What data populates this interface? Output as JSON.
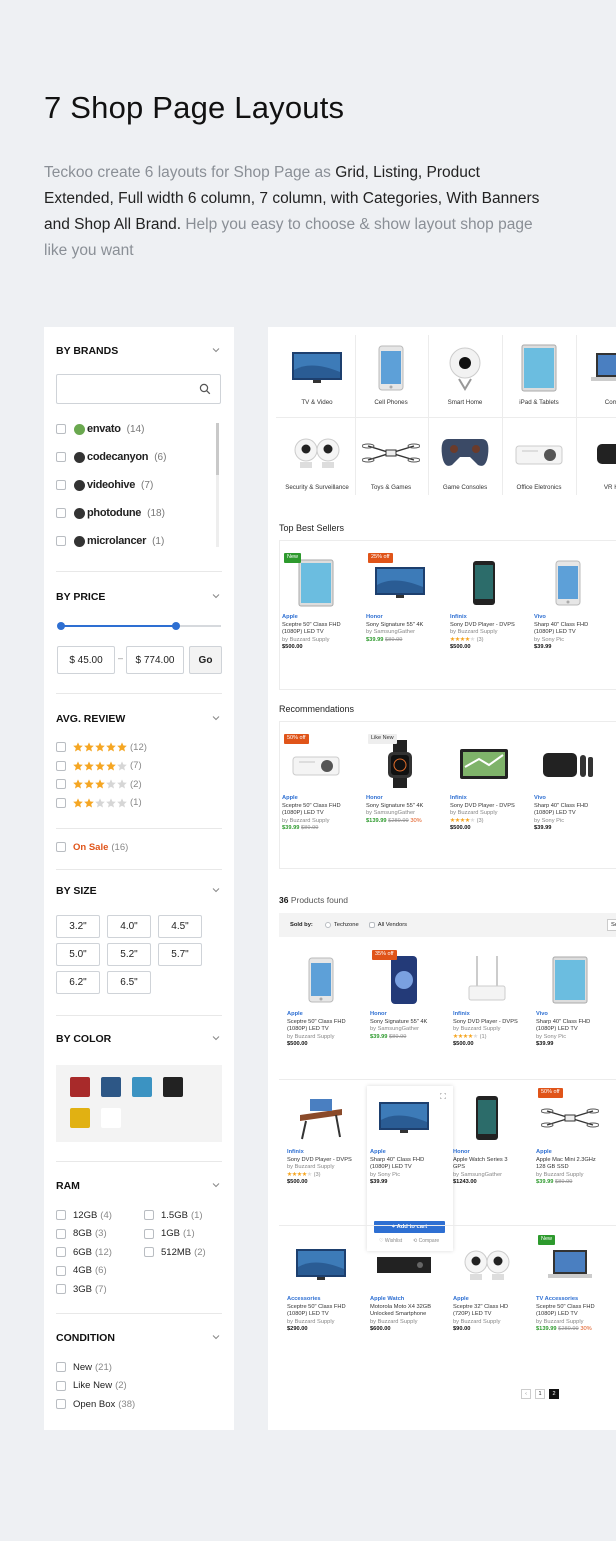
{
  "hero": {
    "title": "7 Shop Page Layouts",
    "desc_muted1": "Teckoo create 6 layouts for Shop Page as ",
    "desc_strong": "Grid, Listing, Product Extended, Full width 6 column, 7 column, with Categories, With Banners and Shop All Brand",
    "desc_dot": ".",
    "desc_muted2": " Help you easy to choose  & show layout shop page like you want"
  },
  "sidebar": {
    "brands": {
      "title": "BY BRANDS",
      "items": [
        {
          "name": "envato",
          "count": "(14)"
        },
        {
          "name": "codecanyon",
          "count": "(6)"
        },
        {
          "name": "videohive",
          "count": "(7)"
        },
        {
          "name": "photodune",
          "count": "(18)"
        },
        {
          "name": "microlancer",
          "count": "(1)"
        }
      ]
    },
    "price": {
      "title": "BY PRICE",
      "min": "$ 45.00",
      "sep": "–",
      "max": "$ 774.00",
      "go": "Go",
      "range_low_pct": 0,
      "range_high_pct": 72
    },
    "review": {
      "title": "AVG. REVIEW",
      "items": [
        {
          "stars": 5,
          "count": "(12)"
        },
        {
          "stars": 4,
          "count": "(7)"
        },
        {
          "stars": 3,
          "count": "(2)"
        },
        {
          "stars": 2,
          "count": "(1)"
        }
      ]
    },
    "onsale": {
      "label": "On Sale",
      "count": "(16)"
    },
    "size": {
      "title": "BY SIZE",
      "items": [
        "3.2\"",
        "4.0\"",
        "4.5\"",
        "5.0\"",
        "5.2\"",
        "5.7\"",
        "6.2\"",
        "6.5\""
      ]
    },
    "color": {
      "title": "BY COLOR",
      "swatches": [
        "#a82a2a",
        "#2d5786",
        "#3b93c2",
        "#222222",
        "#e1b112",
        "#ffffff"
      ]
    },
    "ram": {
      "title": "RAM",
      "left": [
        {
          "label": "12GB",
          "count": "(4)"
        },
        {
          "label": "8GB",
          "count": "(3)"
        },
        {
          "label": "6GB",
          "count": "(12)"
        },
        {
          "label": "4GB",
          "count": "(6)"
        },
        {
          "label": "3GB",
          "count": "(7)"
        }
      ],
      "right": [
        {
          "label": "1.5GB",
          "count": "(1)"
        },
        {
          "label": "1GB",
          "count": "(1)"
        },
        {
          "label": "512MB",
          "count": "(2)"
        }
      ]
    },
    "condition": {
      "title": "CONDITION",
      "items": [
        {
          "label": "New",
          "count": "(21)"
        },
        {
          "label": "Like New",
          "count": "(2)"
        },
        {
          "label": "Open Box",
          "count": "(38)"
        }
      ]
    }
  },
  "main": {
    "categories_row1": [
      "TV & Video",
      "Cell Phones",
      "Smart Home",
      "iPad & Tablets",
      "Comp"
    ],
    "categories_row2": [
      "Security & Surveillance",
      "Toys & Games",
      "Game Consoles",
      "Office Eletronics",
      "VR Ha"
    ],
    "best_sellers": {
      "title": "Top Best Sellers",
      "items": [
        {
          "badge": "New",
          "brand": "Apple",
          "name": "Sceptre 50\" Class FHD (1080P) LED TV",
          "by": "by Buzzard Supply",
          "price": "$500.00",
          "old": "",
          "off": "",
          "rating": ""
        },
        {
          "badge": "25% off",
          "brand": "Honor",
          "name": "Sony Signature 55\" 4K",
          "by": "by SamsungGather",
          "price": "$39.99",
          "old": "$89.99",
          "off": "",
          "rating": ""
        },
        {
          "badge": "",
          "brand": "Infinix",
          "name": "Sony DVD Player - DVPS",
          "by": "by Buzzard Supply",
          "price": "$500.00",
          "old": "",
          "off": "",
          "rating": "(3)"
        },
        {
          "badge": "",
          "brand": "Vivo",
          "name": "Sharp 40\" Class FHD (1080P) LED TV",
          "by": "by Sony Pic",
          "price": "$39.99",
          "old": "",
          "off": "",
          "rating": ""
        }
      ]
    },
    "recommendations": {
      "title": "Recommendations",
      "items": [
        {
          "badge": "50% off",
          "brand": "Apple",
          "name": "Sceptre 50\" Class FHD (1080P) LED TV",
          "by": "by Buzzard Supply",
          "price": "$39.99",
          "old": "$89.99",
          "off": "",
          "rating": ""
        },
        {
          "badge": "Like New",
          "brand": "Honor",
          "name": "Sony Signature 55\" 4K",
          "by": "by SamsungGather",
          "price": "$139.99",
          "old": "$289.99",
          "off": "30%",
          "rating": ""
        },
        {
          "badge": "",
          "brand": "Infinix",
          "name": "Sony DVD Player - DVPS",
          "by": "by Buzzard Supply",
          "price": "$500.00",
          "old": "",
          "off": "",
          "rating": "(3)"
        },
        {
          "badge": "",
          "brand": "Vivo",
          "name": "Sharp 40\" Class FHD (1080P) LED TV",
          "by": "by Sony Pic",
          "price": "$39.99",
          "old": "",
          "off": "",
          "rating": ""
        }
      ]
    },
    "found": {
      "count": "36",
      "label": " Products found"
    },
    "soldby": {
      "label": "Sold by:",
      "opt1": "Techzone",
      "opt2": "All Vendors",
      "sort": "So"
    },
    "grid": [
      {
        "badge": "",
        "brand": "Apple",
        "name": "Sceptre 50\" Class FHD (1080P) LED TV",
        "by": "by Buzzard Supply",
        "price": "$500.00",
        "old": "",
        "off": "",
        "rating": ""
      },
      {
        "badge": "35% off",
        "brand": "Honor",
        "name": "Sony Signature 55\" 4K",
        "by": "by SamsungGather",
        "price": "$39.99",
        "old": "$89.99",
        "off": "",
        "rating": ""
      },
      {
        "badge": "",
        "brand": "Infinix",
        "name": "Sony DVD Player - DVPS",
        "by": "by Buzzard Supply",
        "price": "$500.00",
        "old": "",
        "off": "",
        "rating": "(1)"
      },
      {
        "badge": "",
        "brand": "Vivo",
        "name": "Sharp 40\" Class FHD (1080P) LED TV",
        "by": "by Sony Pic",
        "price": "$39.99",
        "old": "",
        "off": "",
        "rating": ""
      },
      {
        "badge": "",
        "brand": "Infinix",
        "name": "Sony DVD Player - DVPS",
        "by": "by Buzzard Supply",
        "price": "$500.00",
        "old": "",
        "off": "",
        "rating": "(3)"
      },
      {
        "badge": "",
        "brand": "Apple",
        "name": "Sharp 40\" Class FHD (1080P) LED TV",
        "by": "by Sony Pic",
        "price": "$39.99",
        "old": "",
        "off": "",
        "rating": ""
      },
      {
        "badge": "",
        "brand": "Honor",
        "name": "Apple Watch Series 3 GPS",
        "by": "by SamsungGather",
        "price": "$1243.00",
        "old": "",
        "off": "",
        "rating": ""
      },
      {
        "badge": "50% off",
        "brand": "Apple",
        "name": "Apple Mac Mini 2.3GHz 128 GB SSD",
        "by": "by Buzzard Supply",
        "price": "$39.99",
        "old": "$89.99",
        "off": "",
        "rating": ""
      },
      {
        "badge": "",
        "brand": "Accessories",
        "name": "Sceptre 50\" Class FHD (1080P) LED TV",
        "by": "by Buzzard Supply",
        "price": "$290.00",
        "old": "",
        "off": "",
        "rating": ""
      },
      {
        "badge": "",
        "brand": "Apple Watch",
        "name": "Motorola Moto X4 32GB Unlocked Smartphone",
        "by": "by Buzzard Supply",
        "price": "$600.00",
        "old": "",
        "off": "",
        "rating": ""
      },
      {
        "badge": "",
        "brand": "Apple",
        "name": "Sceptre 32\" Class HD (720P) LED TV",
        "by": "by Buzzard Supply",
        "price": "$90.00",
        "old": "",
        "off": "",
        "rating": ""
      },
      {
        "badge": "New",
        "brand": "TV Accessories",
        "name": "Sceptre 50\" Class FHD (1080P) LED TV",
        "by": "by Buzzard Supply",
        "price": "$139.99",
        "old": "$289.99",
        "off": "30%",
        "rating": ""
      }
    ],
    "hover": {
      "add_to_cart": "+ Add to cart",
      "wishlist": "Wishlist",
      "compare": "Compare"
    },
    "pagination": {
      "prev": "‹",
      "p1": "1",
      "p2": "2"
    },
    "colors": {
      "accent": "#2e6fd2",
      "sale": "#e05419",
      "green": "#2d9a2d",
      "new_badge": "#2d9a2d",
      "off_badge": "#e05419"
    }
  }
}
